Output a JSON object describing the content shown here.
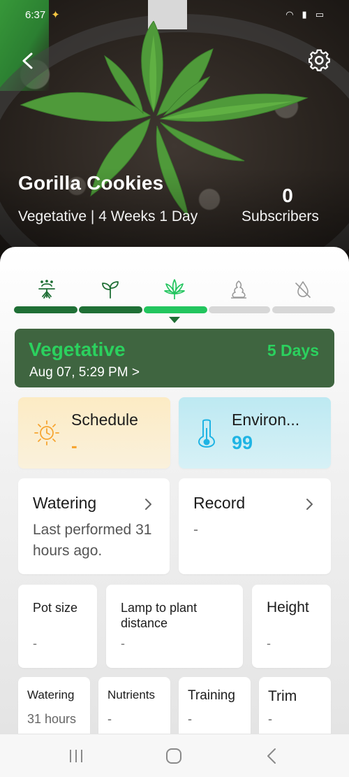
{
  "status_bar": {
    "time": "6:37",
    "battery": ""
  },
  "header": {
    "plant_name": "Gorilla Cookies",
    "stage_info": "Vegetative | 4 Weeks 1 Day",
    "subscribers_count": "0",
    "subscribers_label": "Subscribers"
  },
  "stages": [
    {
      "name": "germination",
      "icon": "germination-icon",
      "state": "done"
    },
    {
      "name": "seedling",
      "icon": "seedling-icon",
      "state": "done"
    },
    {
      "name": "vegetative",
      "icon": "cannabis-leaf-icon",
      "state": "active"
    },
    {
      "name": "flowering",
      "icon": "bud-icon",
      "state": "pending"
    },
    {
      "name": "drying",
      "icon": "drying-icon",
      "state": "pending"
    }
  ],
  "stage_card": {
    "title": "Vegetative",
    "days": "5 Days",
    "date": "Aug 07, 5:29 PM >"
  },
  "schedule": {
    "title": "Schedule",
    "value": "-"
  },
  "environment": {
    "title": "Environ...",
    "value": "99"
  },
  "watering": {
    "title": "Watering",
    "subtitle": "Last performed 31 hours ago."
  },
  "record": {
    "title": "Record",
    "value": "-"
  },
  "metrics": {
    "pot_size": {
      "label": "Pot size",
      "value": "-"
    },
    "lamp_distance": {
      "label": "Lamp to plant distance",
      "value": "-"
    },
    "height": {
      "label": "Height",
      "value": "-"
    }
  },
  "activities": {
    "watering": {
      "label": "Watering",
      "value": "31 hours"
    },
    "nutrients": {
      "label": "Nutrients",
      "value": "-"
    },
    "training": {
      "label": "Training",
      "value": "-"
    },
    "trim": {
      "label": "Trim",
      "value": "-"
    }
  },
  "colors": {
    "accent_green": "#2bd15e",
    "dark_green": "#1f6f35",
    "stage_card_bg": "#3f6540",
    "schedule_orange": "#f6a531",
    "environment_blue": "#1fb4e4"
  }
}
